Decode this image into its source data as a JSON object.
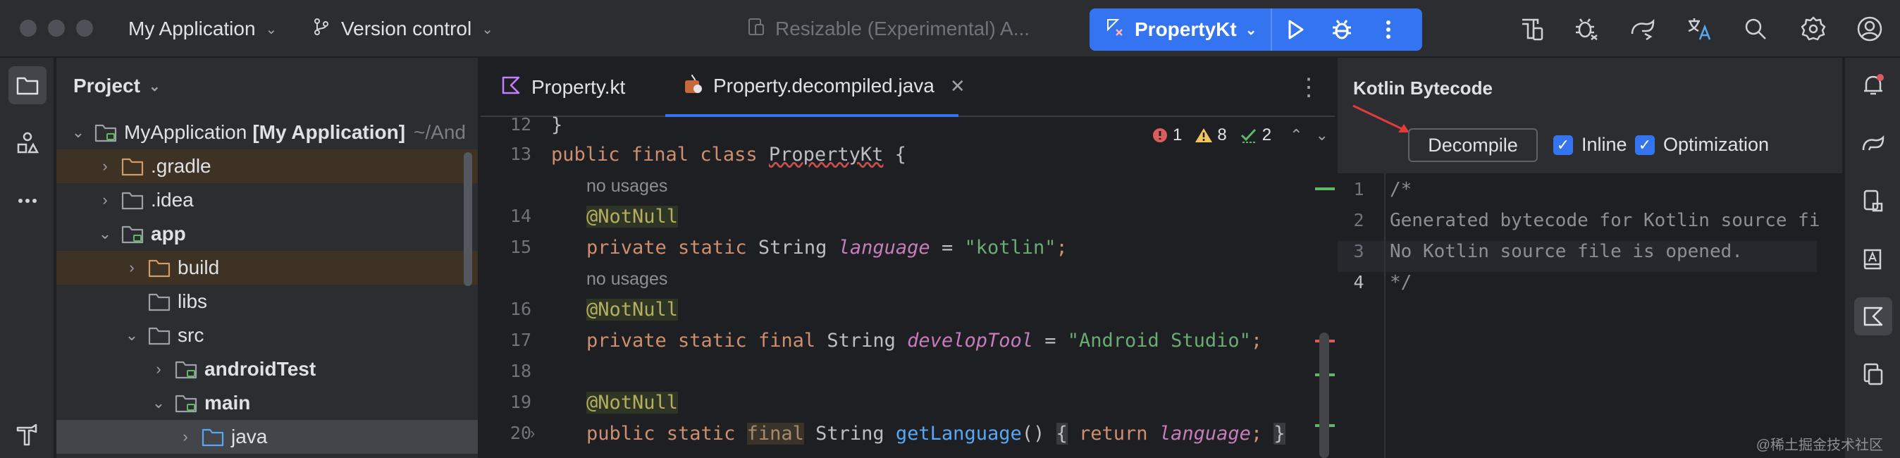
{
  "titlebar": {
    "project_name": "My Application",
    "vcs_label": "Version control",
    "device_label": "Resizable (Experimental) A...",
    "run_config": "PropertyKt",
    "icons": [
      "device-manager-icon",
      "bug-report-icon",
      "gradle-sync-icon",
      "translate-icon",
      "search-icon",
      "settings-icon",
      "account-icon"
    ]
  },
  "project": {
    "header": "Project",
    "tree": [
      {
        "label": "MyApplication",
        "bold_suffix": "[My Application]",
        "muted": "~/And",
        "indent": 0,
        "arrow": "down",
        "icon": "module"
      },
      {
        "label": ".gradle",
        "indent": 1,
        "arrow": "right",
        "icon": "folder-orange",
        "excluded": true
      },
      {
        "label": ".idea",
        "indent": 1,
        "arrow": "right",
        "icon": "folder"
      },
      {
        "label": "app",
        "indent": 1,
        "arrow": "down",
        "icon": "module",
        "bold": true
      },
      {
        "label": "build",
        "indent": 2,
        "arrow": "right",
        "icon": "folder-orange",
        "excluded": true
      },
      {
        "label": "libs",
        "indent": 2,
        "arrow": "",
        "icon": "folder"
      },
      {
        "label": "src",
        "indent": 2,
        "arrow": "down",
        "icon": "folder"
      },
      {
        "label": "androidTest",
        "indent": 3,
        "arrow": "right",
        "icon": "module",
        "bold": true
      },
      {
        "label": "main",
        "indent": 3,
        "arrow": "down",
        "icon": "module",
        "bold": true
      },
      {
        "label": "java",
        "indent": 4,
        "arrow": "right",
        "icon": "folder-blue",
        "selected": true
      }
    ]
  },
  "editor": {
    "tabs": [
      {
        "label": "Property.kt",
        "active": false
      },
      {
        "label": "Property.decompiled.java",
        "active": true
      }
    ],
    "inspections": {
      "errors": "1",
      "warnings": "8",
      "weak": "2"
    },
    "line_numbers": [
      "12",
      "13",
      "",
      "14",
      "15",
      "",
      "16",
      "17",
      "18",
      "19",
      "20"
    ],
    "hints": {
      "no_usages": "no usages"
    },
    "code": {
      "l12": "}",
      "l13_kw": "public final class ",
      "l13_cls": "PropertyKt",
      "l13_end": " {",
      "ann": "@NotNull",
      "l15_kw": "private static ",
      "l15_type": "String ",
      "l15_field": "language",
      "l15_eq": " = ",
      "l15_str": "\"kotlin\"",
      "l15_end": ";",
      "l17_kw": "private static final ",
      "l17_type": "String ",
      "l17_field": "developTool",
      "l17_eq": " = ",
      "l17_str": "\"Android Studio\"",
      "l17_end": ";",
      "l20_kw": "public static ",
      "l20_final": "final",
      "l20_type": " String ",
      "l20_fn": "getLanguage",
      "l20_paren": "() ",
      "l20_brace_open": "{",
      "l20_return": " return ",
      "l20_field": "language",
      "l20_semi": "; ",
      "l20_brace_close": "}"
    }
  },
  "bytecode": {
    "title": "Kotlin Bytecode",
    "decompile_label": "Decompile",
    "inline_label": "Inline",
    "optimization_label": "Optimization",
    "lines": [
      "/*",
      "Generated bytecode for Kotlin source fi",
      "No Kotlin source file is opened.",
      "*/"
    ],
    "line_numbers": [
      "1",
      "2",
      "3",
      "4"
    ]
  },
  "watermark": "@稀土掘金技术社区",
  "colors": {
    "accent": "#3574f0",
    "background": "#1e1f22",
    "panel": "#2b2d30"
  }
}
